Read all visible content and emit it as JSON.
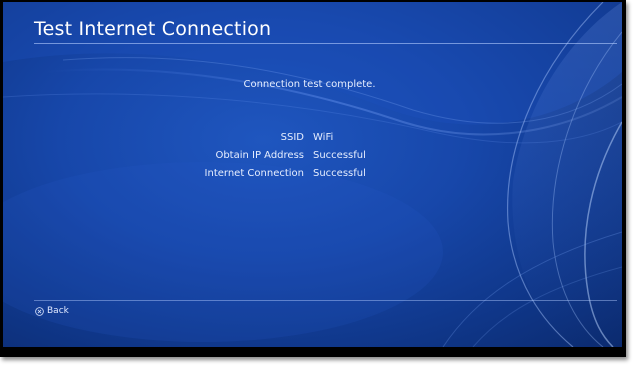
{
  "screen": {
    "title": "Test Internet Connection"
  },
  "message": "Connection test complete.",
  "results": [
    {
      "label": "SSID",
      "value": "WiFi"
    },
    {
      "label": "Obtain IP Address",
      "value": "Successful"
    },
    {
      "label": "Internet Connection",
      "value": "Successful"
    }
  ],
  "footer": {
    "back_icon": "cross-icon",
    "back_label": "Back"
  },
  "colors": {
    "background": "#1747aa",
    "text": "#ffffff"
  }
}
